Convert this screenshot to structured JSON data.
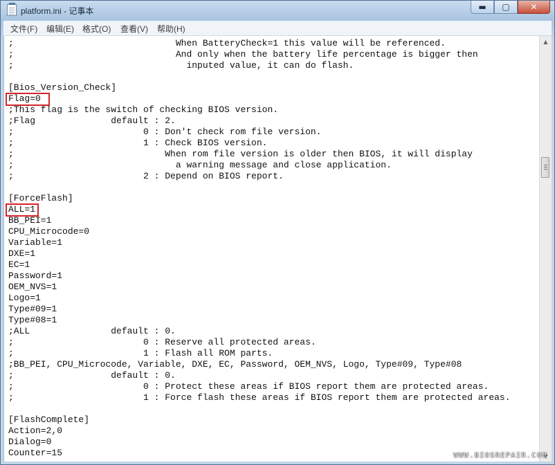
{
  "window": {
    "title": "platform.ini - 记事本",
    "controls": {
      "minimize": "▬",
      "maximize": "▢",
      "close": "✕"
    }
  },
  "menubar": {
    "items": [
      {
        "label": "文件(F)"
      },
      {
        "label": "编辑(E)"
      },
      {
        "label": "格式(O)"
      },
      {
        "label": "查看(V)"
      },
      {
        "label": "帮助(H)"
      }
    ]
  },
  "document": {
    "lines": [
      ";                              When BatteryCheck=1 this value will be referenced.",
      ";                              And only when the battery life percentage is bigger then",
      ";                                inputed value, it can do flash.",
      "",
      "[Bios_Version_Check]",
      "Flag=0",
      ";This flag is the switch of checking BIOS version.",
      ";Flag              default : 2.",
      ";                        0 : Don't check rom file version.",
      ";                        1 : Check BIOS version.",
      ";                            When rom file version is older then BIOS, it will display",
      ";                              a warning message and close application.",
      ";                        2 : Depend on BIOS report.",
      "",
      "[ForceFlash]",
      "ALL=1",
      "BB_PEI=1",
      "CPU_Microcode=0",
      "Variable=1",
      "DXE=1",
      "EC=1",
      "Password=1",
      "OEM_NVS=1",
      "Logo=1",
      "Type#09=1",
      "Type#08=1",
      ";ALL               default : 0.",
      ";                        0 : Reserve all protected areas.",
      ";                        1 : Flash all ROM parts.",
      ";BB_PEI, CPU_Microcode, Variable, DXE, EC, Password, OEM_NVS, Logo, Type#09, Type#08",
      ";                  default : 0.",
      ";                        0 : Protect these areas if BIOS report them are protected areas.",
      ";                        1 : Force flash these areas if BIOS report them are protected areas.",
      "",
      "[FlashComplete]",
      "Action=2,0",
      "Dialog=0",
      "Counter=15"
    ]
  },
  "highlight_color": "#d4252b",
  "watermark": "WWW.BIOSREPAIR.COM"
}
